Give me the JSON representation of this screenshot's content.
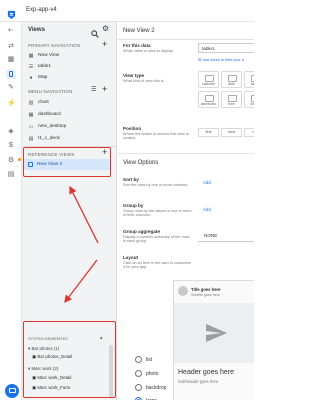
{
  "app": {
    "title": "Exp-app-v4",
    "accent": "#1a73e8",
    "annotation_color": "#e0342e"
  },
  "rail": {
    "icons": [
      "back-arrow-icon",
      "swap-icon",
      "table-icon",
      "phone-icon",
      "tools-icon",
      "bolt-icon",
      "shield-icon",
      "dollar-icon",
      "settings-icon",
      "document-icon",
      "chat-icon"
    ]
  },
  "views_panel": {
    "title": "Views",
    "primary_header": "PRIMARY NAVIGATION",
    "primary_items": [
      {
        "label": "New View",
        "icon": "grid-icon"
      },
      {
        "label": "table1",
        "icon": "list-icon"
      },
      {
        "label": "Map",
        "icon": "map-pin-icon"
      }
    ],
    "menu_header": "MENU NAVIGATION",
    "menu_items": [
      {
        "label": "chart",
        "icon": "chart-icon"
      },
      {
        "label": "dashboard",
        "icon": "dashboard-icon"
      },
      {
        "label": "new_desktop",
        "icon": "desktop-icon"
      },
      {
        "label": "t1_c_deck",
        "icon": "deck-icon"
      }
    ],
    "reference_header": "REFERENCE VIEWS",
    "reference_items": [
      {
        "label": "New View 2",
        "icon": "view-icon"
      }
    ],
    "system_header": "SYSTEM GENERATED",
    "system_groups": [
      {
        "label": "Bar photos (1)",
        "items": [
          "Bar photos_Detail"
        ]
      },
      {
        "label": "Marc work (2)",
        "items": [
          "Marc work_Detail",
          "Marc work_Form"
        ]
      }
    ]
  },
  "editor": {
    "view_name_title": "New View 2",
    "for_data_label": "For this data",
    "for_data_help": "Which table or slice to display.",
    "data_value": "table1",
    "slice_link": "Use slices to filter your d",
    "view_type_label": "View type",
    "view_type_help": "What kind of view this is.",
    "view_types": [
      "calendar",
      "deck",
      "table",
      "dashboard",
      "form",
      "detail"
    ],
    "position_label": "Position",
    "position_help": "Where the button to access this view is located.",
    "positions": [
      "first",
      "next",
      "mi"
    ],
    "options_header": "View Options",
    "sort_label": "Sort by",
    "sort_help": "Sort the rows by one or more columns.",
    "sort_add": "Add",
    "group_label": "Group by",
    "group_help": "Group rows by the values in one or more of their columns.",
    "group_add": "Add",
    "aggregate_label": "Group aggregate",
    "aggregate_help": "Display a numeric summary of the rows in each group.",
    "aggregate_value": "NONE",
    "layout_label": "Layout",
    "layout_help": "Click on an item in the card to customize it for your app.",
    "layout_options": [
      "list",
      "photo",
      "backdrop",
      "large"
    ],
    "layout_selected": "large",
    "card_title": "Title goes here",
    "card_subtitle": "Subtitle goes here",
    "card_header": "Header goes here",
    "card_subheader": "Subheader goes here"
  }
}
